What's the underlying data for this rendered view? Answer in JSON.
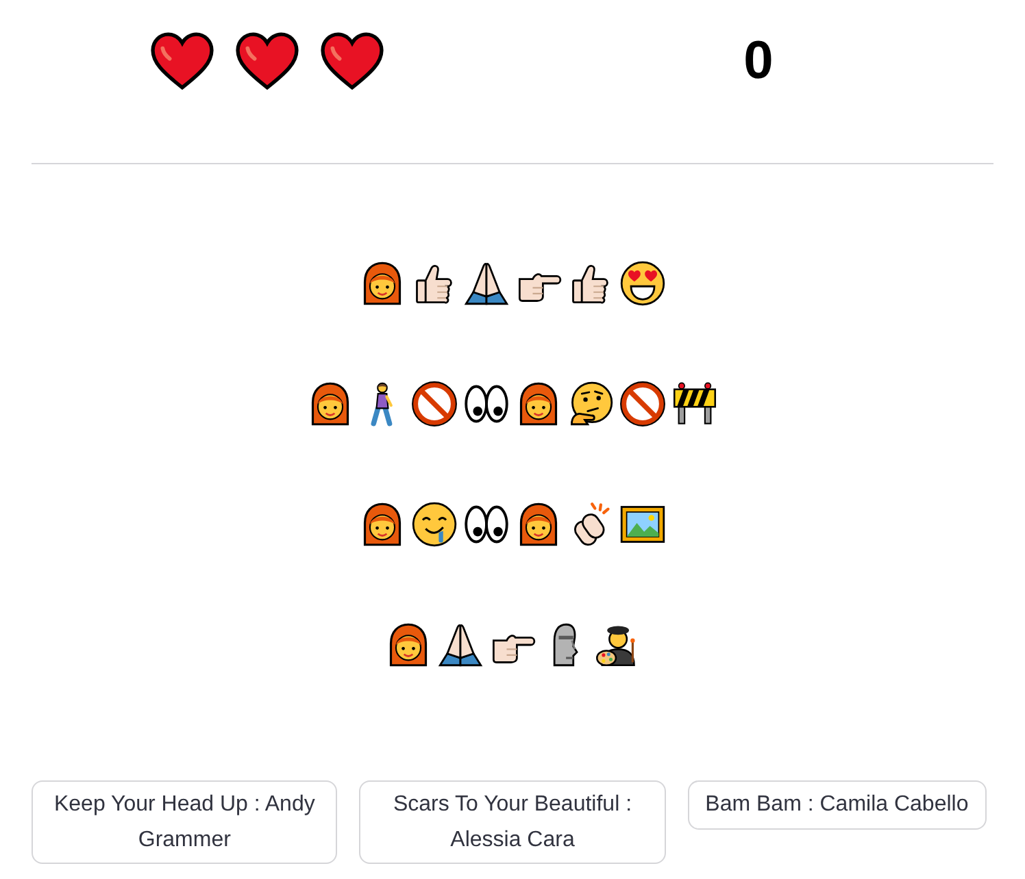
{
  "lives": [
    {
      "lost": false
    },
    {
      "lost": false
    },
    {
      "lost": false
    }
  ],
  "score": "0",
  "clues": [
    {
      "emojis": [
        {
          "kind": "woman"
        },
        {
          "kind": "thumbsup"
        },
        {
          "kind": "pray"
        },
        {
          "kind": "point"
        },
        {
          "kind": "thumbsup"
        },
        {
          "kind": "hearteyes"
        }
      ]
    },
    {
      "emojis": [
        {
          "kind": "woman"
        },
        {
          "kind": "walk"
        },
        {
          "kind": "prohibited"
        },
        {
          "kind": "eyes"
        },
        {
          "kind": "woman"
        },
        {
          "kind": "thinking"
        },
        {
          "kind": "prohibited"
        },
        {
          "kind": "barrier"
        }
      ]
    },
    {
      "emojis": [
        {
          "kind": "woman"
        },
        {
          "kind": "drool"
        },
        {
          "kind": "eyes"
        },
        {
          "kind": "woman"
        },
        {
          "kind": "clap"
        },
        {
          "kind": "picture"
        }
      ]
    },
    {
      "emojis": [
        {
          "kind": "woman"
        },
        {
          "kind": "pray"
        },
        {
          "kind": "point"
        },
        {
          "kind": "moai"
        },
        {
          "kind": "artist"
        }
      ]
    }
  ],
  "answers": [
    "Keep Your Head Up : Andy Grammer",
    "Scars To Your Beautiful : Alessia Cara",
    "Bam Bam : Camila Cabello"
  ]
}
